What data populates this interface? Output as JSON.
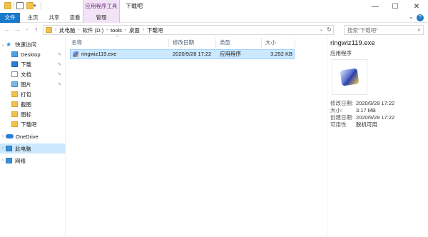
{
  "window": {
    "title": "下载吧",
    "context_tab_group": "应用程序工具"
  },
  "ribbon": {
    "tabs": [
      {
        "label": "文件"
      },
      {
        "label": "主页"
      },
      {
        "label": "共享"
      },
      {
        "label": "查看"
      },
      {
        "label": "管理"
      }
    ]
  },
  "address": {
    "crumbs": [
      "此电脑",
      "软件 (D:)",
      "tools",
      "桌面",
      "下载吧"
    ],
    "search_placeholder": "搜索\"下载吧\""
  },
  "nav": {
    "items": [
      {
        "label": "快速访问",
        "icon": "star-icon"
      },
      {
        "label": "Desktop",
        "icon": "desktop-icon",
        "pinned": true
      },
      {
        "label": "下载",
        "icon": "download-icon",
        "pinned": true
      },
      {
        "label": "文档",
        "icon": "document-icon",
        "pinned": true
      },
      {
        "label": "图片",
        "icon": "picture-icon",
        "pinned": true
      },
      {
        "label": "打包",
        "icon": "folder-icon"
      },
      {
        "label": "截图",
        "icon": "folder-icon"
      },
      {
        "label": "图标",
        "icon": "folder-icon"
      },
      {
        "label": "下载吧",
        "icon": "folder-icon"
      },
      {
        "label": "OneDrive",
        "icon": "onedrive-icon"
      },
      {
        "label": "此电脑",
        "icon": "pc-icon",
        "selected": true
      },
      {
        "label": "网络",
        "icon": "network-icon"
      }
    ]
  },
  "files": {
    "columns": [
      "名称",
      "修改日期",
      "类型",
      "大小"
    ],
    "rows": [
      {
        "name": "ringwiz119.exe",
        "modified": "2020/9/28 17:22",
        "type": "应用程序",
        "size": "3,252 KB"
      }
    ]
  },
  "details": {
    "filename": "ringwiz119.exe",
    "kind": "应用程序",
    "props": [
      {
        "key": "修改日期:",
        "value": "2020/9/28 17:22"
      },
      {
        "key": "大小:",
        "value": "3.17 MB"
      },
      {
        "key": "创建日期:",
        "value": "2020/9/28 17:22"
      },
      {
        "key": "可用性:",
        "value": "脱机可用"
      }
    ]
  },
  "colors": {
    "accent": "#1979ca",
    "selection": "#cce8ff",
    "context_tab": "#f2e4f6"
  }
}
